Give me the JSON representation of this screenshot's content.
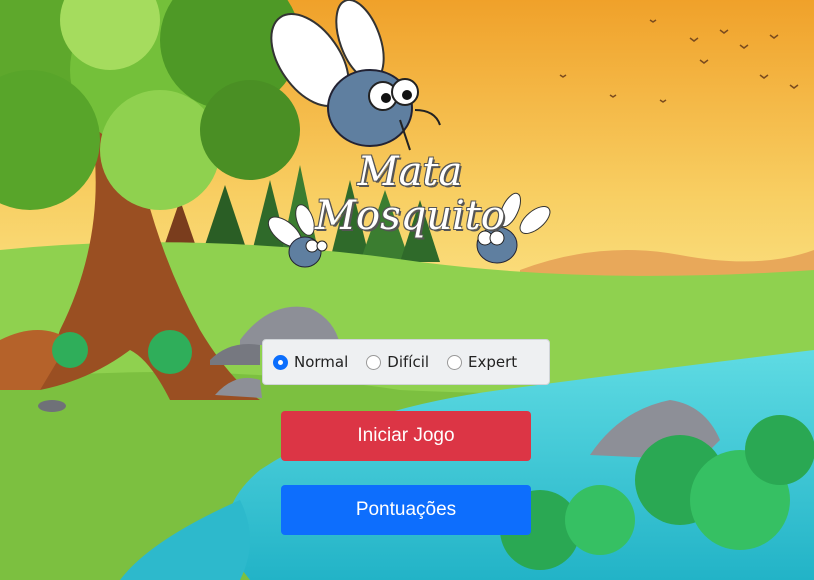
{
  "game": {
    "title_line1": "Mata",
    "title_line2": "Mosquito"
  },
  "difficulty": {
    "selected": "Normal",
    "options": [
      {
        "label": "Normal",
        "checked": true
      },
      {
        "label": "Difícil",
        "checked": false
      },
      {
        "label": "Expert",
        "checked": false
      }
    ]
  },
  "buttons": {
    "start_label": "Iniciar Jogo",
    "scores_label": "Pontuações"
  },
  "colors": {
    "start_button": "#dc3545",
    "scores_button": "#0d6efd",
    "sky_top": "#f2a62a",
    "sky_bottom": "#fbe58a",
    "grass": "#8fd14f",
    "river": "#35c8d6"
  }
}
